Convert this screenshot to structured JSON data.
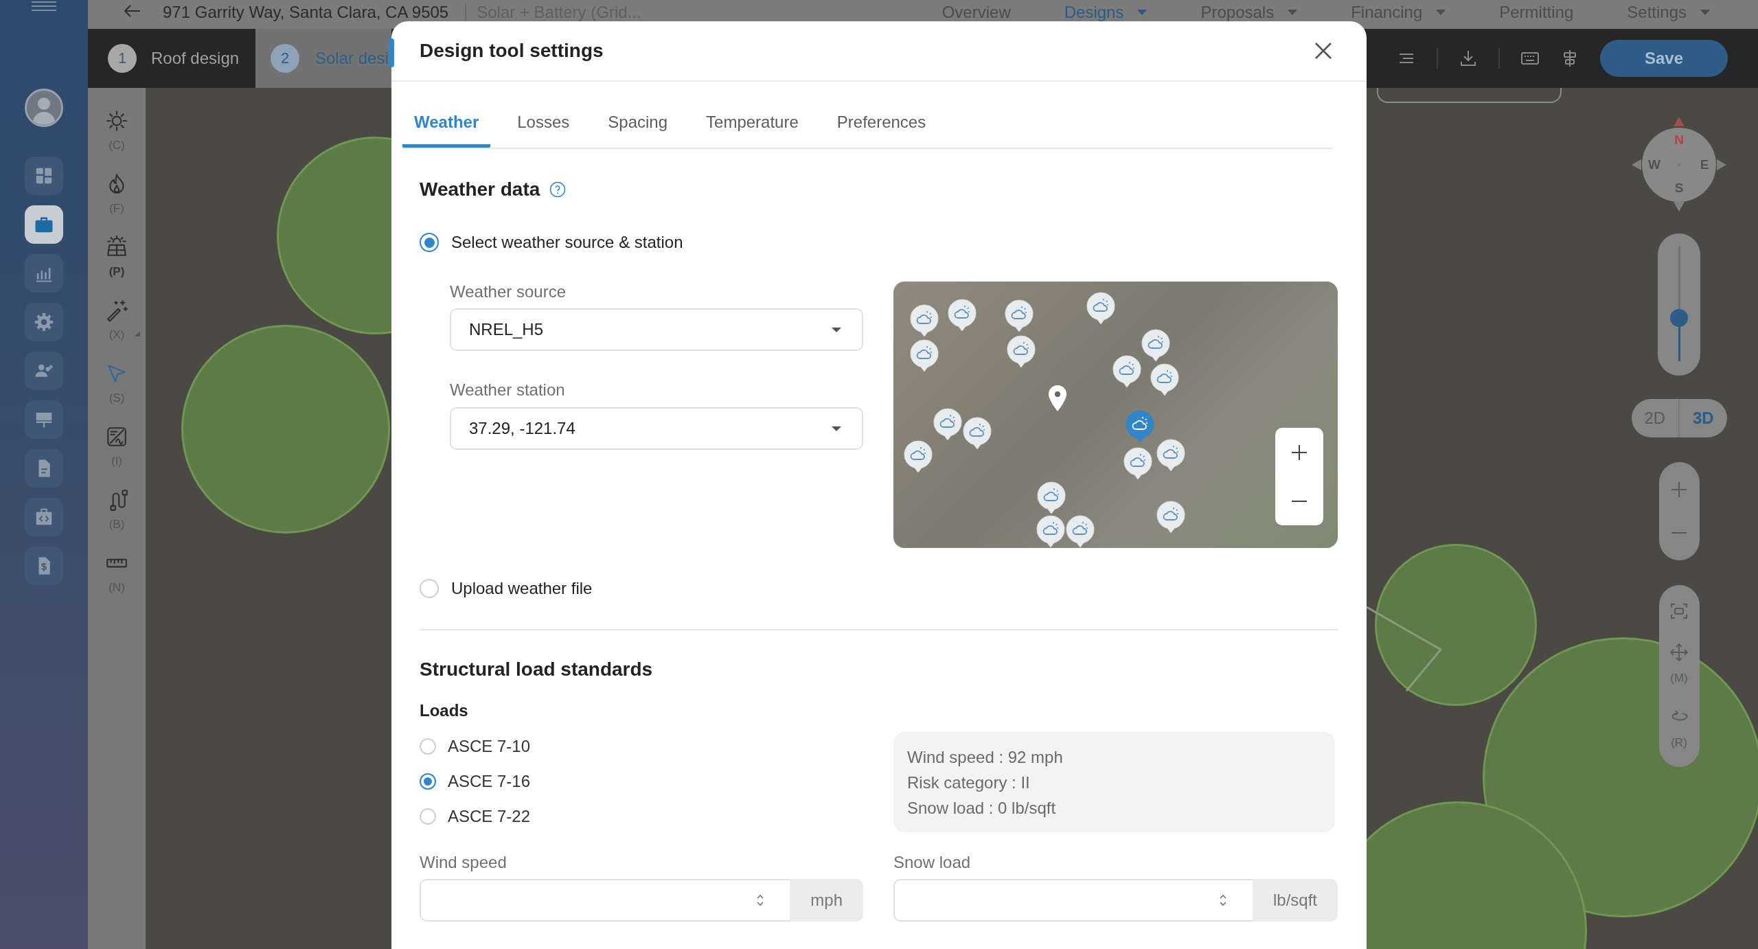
{
  "nav_rail": {
    "items": [
      {
        "selected": false
      },
      {
        "selected": true
      },
      {
        "selected": false
      },
      {
        "selected": false
      },
      {
        "selected": false
      },
      {
        "selected": false
      },
      {
        "selected": false
      },
      {
        "selected": false
      },
      {
        "selected": false
      }
    ]
  },
  "header": {
    "address": "971 Garrity Way, Santa Clara, CA 9505",
    "project_type": "Solar + Battery (Grid...",
    "nav": [
      {
        "label": "Overview",
        "selected": false,
        "dropdown": false
      },
      {
        "label": "Designs",
        "selected": true,
        "dropdown": true
      },
      {
        "label": "Proposals",
        "selected": false,
        "dropdown": true
      },
      {
        "label": "Financing",
        "selected": false,
        "dropdown": true
      },
      {
        "label": "Permitting",
        "selected": false,
        "dropdown": false
      },
      {
        "label": "Settings",
        "selected": false,
        "dropdown": true
      }
    ]
  },
  "steps": [
    {
      "number": "1",
      "label": "Roof design",
      "selected": false
    },
    {
      "number": "2",
      "label": "Solar desi",
      "selected": true
    }
  ],
  "toolbar": {
    "save_button": "Save"
  },
  "tools": [
    {
      "shortcut": "(C)",
      "selected": false,
      "highlighted": false,
      "submenu": false
    },
    {
      "shortcut": "(F)",
      "selected": false,
      "highlighted": false,
      "submenu": false
    },
    {
      "shortcut": "(P)",
      "selected": false,
      "highlighted": true,
      "submenu": false
    },
    {
      "shortcut": "(X)",
      "selected": false,
      "highlighted": false,
      "submenu": true
    },
    {
      "shortcut": "(S)",
      "selected": true,
      "highlighted": false,
      "submenu": false
    },
    {
      "shortcut": "(I)",
      "selected": false,
      "highlighted": false,
      "submenu": false
    },
    {
      "shortcut": "(B)",
      "selected": false,
      "highlighted": false,
      "submenu": false
    },
    {
      "shortcut": "(N)",
      "selected": false,
      "highlighted": false,
      "submenu": false
    }
  ],
  "map_controls": {
    "compass": {
      "north": "N",
      "west": "W",
      "east": "E",
      "south": "S"
    },
    "tilt_slider": {
      "level": 0.38
    },
    "view_modes": [
      {
        "label": "2D",
        "selected": false
      },
      {
        "label": "3D",
        "selected": true
      }
    ],
    "view_tools": [
      {
        "kind": "fit"
      },
      {
        "kind": "move",
        "shortcut": "(M)"
      },
      {
        "kind": "rotate",
        "shortcut": "(R)"
      }
    ]
  },
  "dialog": {
    "title": "Design tool settings",
    "tabs": [
      {
        "label": "Weather",
        "selected": true
      },
      {
        "label": "Losses",
        "selected": false
      },
      {
        "label": "Spacing",
        "selected": false
      },
      {
        "label": "Temperature",
        "selected": false
      },
      {
        "label": "Preferences",
        "selected": false
      }
    ],
    "weather_data": {
      "heading": "Weather data",
      "options": [
        {
          "label": "Select weather source & station",
          "selected": true
        },
        {
          "label": "Upload weather file",
          "selected": false
        }
      ],
      "weather_source": {
        "label": "Weather source",
        "value": "NREL_H5"
      },
      "weather_station": {
        "label": "Weather station",
        "value": "37.29, -121.74"
      },
      "map": {
        "stations": [
          {
            "selected": false
          },
          {
            "selected": false
          },
          {
            "selected": false
          },
          {
            "selected": false
          },
          {
            "selected": false
          },
          {
            "selected": false
          },
          {
            "selected": false
          },
          {
            "selected": false
          },
          {
            "selected": false
          },
          {
            "selected": false
          },
          {
            "selected": false
          },
          {
            "selected": false
          },
          {
            "selected": true
          },
          {
            "selected": false
          },
          {
            "selected": false
          },
          {
            "selected": false
          },
          {
            "selected": false
          },
          {
            "selected": false
          },
          {
            "selected": false
          }
        ]
      }
    },
    "structural": {
      "heading": "Structural load standards",
      "loads_label": "Loads",
      "loads": [
        {
          "label": "ASCE 7-10",
          "selected": false
        },
        {
          "label": "ASCE 7-16",
          "selected": true
        },
        {
          "label": "ASCE 7-22",
          "selected": false
        }
      ],
      "info": [
        "Wind speed : 92 mph",
        "Risk category : II",
        "Snow load : 0 lb/sqft"
      ],
      "fields": [
        {
          "label": "Wind speed",
          "unit": "mph"
        },
        {
          "label": "Snow load",
          "unit": "lb/sqft"
        }
      ]
    }
  }
}
